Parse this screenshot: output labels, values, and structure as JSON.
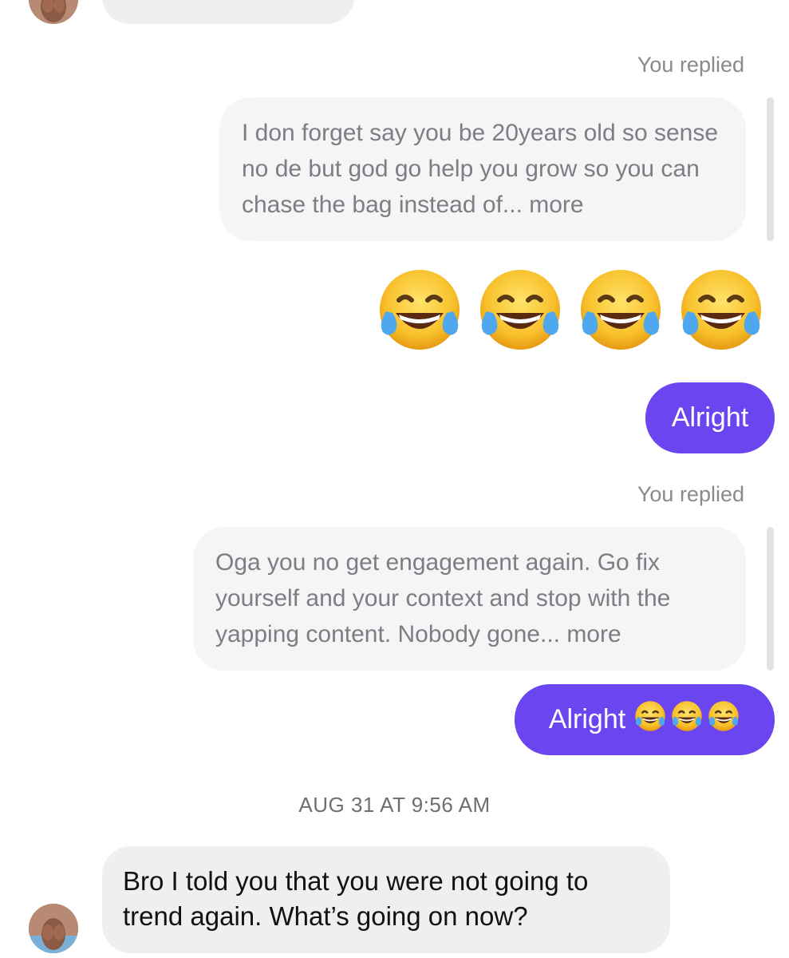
{
  "thread": {
    "reply_label_1": "You replied",
    "quoted_message_1": "I don forget say you be 20years old so sense no de but god go help you grow so you can chase the bag instead of... more",
    "emoji_message": "😂😂😂😂",
    "outgoing_1": "Alright",
    "reply_label_2": "You replied",
    "quoted_message_2": "Oga you no get engagement again. Go fix yourself and your context and stop with the yapping content. Nobody gone... more",
    "outgoing_2": "Alright",
    "outgoing_2_emoji": "😂😂😂",
    "timestamp": "AUG 31 AT 9:56 AM",
    "incoming_1": "Bro I told you that you were not going to trend again. What’s going on now?"
  },
  "colors": {
    "outgoing_bubble": "#6a45f0",
    "incoming_bubble": "#efeff2",
    "quote_bubble": "#f5f5f7",
    "label_text": "#8a8a8e"
  },
  "icons": {
    "emoji": "face-with-tears-of-joy-icon",
    "avatar": "contact-avatar"
  }
}
